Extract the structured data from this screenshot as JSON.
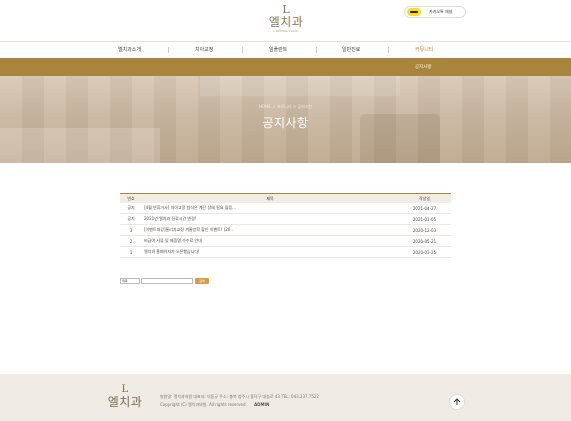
{
  "header": {
    "logo_mark": "L",
    "logo_text": "엘치과",
    "logo_sub": "L DENTAL CLINIC",
    "kakao_label": "카카오톡 채널"
  },
  "nav": {
    "items": [
      {
        "label": "엘치과소개"
      },
      {
        "label": "치아교정"
      },
      {
        "label": "임플란트"
      },
      {
        "label": "일반진료"
      },
      {
        "label": "커뮤니티"
      }
    ],
    "active": "커뮤니티",
    "sub_items": [
      {
        "label": "공지사항"
      }
    ]
  },
  "hero": {
    "breadcrumb": "HOME > 커뮤니티 > 공지사항",
    "title": "공지사항"
  },
  "board": {
    "columns": [
      "번호",
      "제목",
      "작성일"
    ],
    "rows": [
      {
        "num": "공지",
        "title": "[4월 연휴거사] 치아교정 방식은 계단 상태 필요 많음...",
        "date": "2021-04-27"
      },
      {
        "num": "공지",
        "title": "2021년 엘치과 진료시간 변경!",
        "date": "2021-01-05"
      },
      {
        "num": "3",
        "title": "[이벤트대강]울리치교정 겨울방학 할인 이벤트! (20..",
        "date": "2020-12-03"
      },
      {
        "num": "2",
        "title": "비급여 서류 및 제증명 수수료 안내",
        "date": "2020-05-21"
      },
      {
        "num": "1",
        "title": "엘치과 홈페이지가 오픈했습니다!",
        "date": "2020-03-25"
      }
    ]
  },
  "search": {
    "select_value": "제목",
    "button_label": "검색"
  },
  "footer": {
    "logo_mark": "L",
    "logo_text": "엘치과",
    "line1": "병원명: 엘치과의원   대표자: 이동규   주소: 충북 청주시 흥덕구 대농로 43   TEL: 043.237.7522",
    "line2": "Copyright (C) 엘치과의원. All rights reserved.",
    "admin_label": "ADMIN"
  },
  "colors": {
    "accent": "#a8843c",
    "active_nav": "#c28a1a",
    "kakao": "#f7e01a",
    "footer_bg": "#efeae4"
  },
  "icons": [
    "kakao-icon",
    "arrow-up-icon"
  ]
}
